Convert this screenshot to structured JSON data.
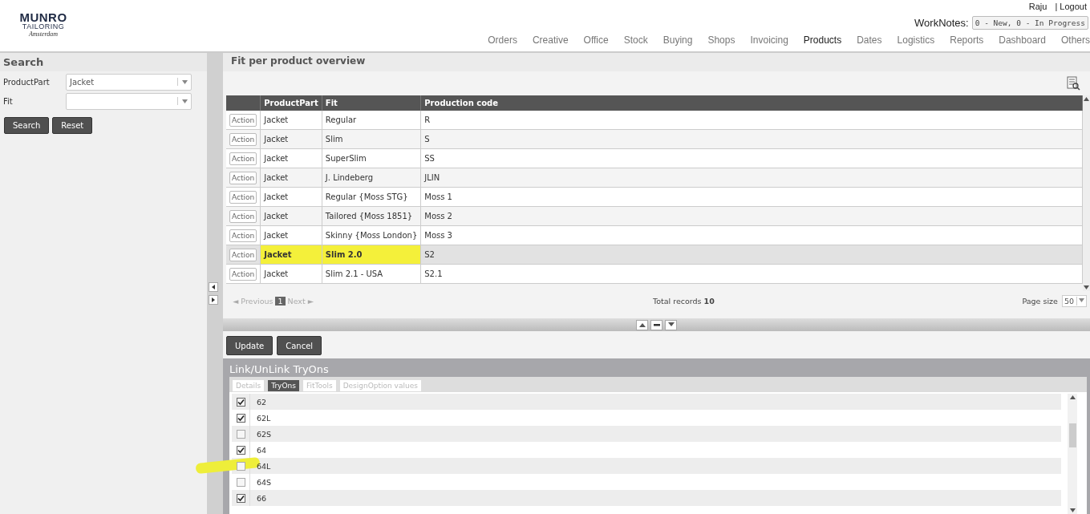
{
  "header": {
    "logo": {
      "name": "MUNRO",
      "sub": "TAILORING",
      "tagline": "Amsterdam"
    },
    "user": "Raju",
    "logout": "| Logout",
    "worknotes_label": "WorkNotes:",
    "worknotes_value": "0 - New, 0 - In Progress",
    "nav": [
      {
        "label": "Orders",
        "selected": false
      },
      {
        "label": "Creative",
        "selected": false
      },
      {
        "label": "Office",
        "selected": false
      },
      {
        "label": "Stock",
        "selected": false
      },
      {
        "label": "Buying",
        "selected": false
      },
      {
        "label": "Shops",
        "selected": false
      },
      {
        "label": "Invoicing",
        "selected": false
      },
      {
        "label": "Products",
        "selected": true
      },
      {
        "label": "Dates",
        "selected": false
      },
      {
        "label": "Logistics",
        "selected": false
      },
      {
        "label": "Reports",
        "selected": false
      },
      {
        "label": "Dashboard",
        "selected": false
      },
      {
        "label": "Others",
        "selected": false
      }
    ]
  },
  "search": {
    "title": "Search",
    "fields": [
      {
        "label": "ProductPart",
        "value": "Jacket"
      },
      {
        "label": "Fit"
      }
    ],
    "buttons": [
      "Search",
      "Reset"
    ]
  },
  "overview": {
    "title": "Fit per product overview",
    "columns": [
      "",
      "ProductPart",
      "Fit",
      "Production code"
    ],
    "rows": [
      {
        "action": "Action",
        "part": "Jacket",
        "fit": "Regular",
        "code": "R",
        "selected": false,
        "marked": false
      },
      {
        "action": "Action",
        "part": "Jacket",
        "fit": "Slim",
        "code": "S",
        "selected": false,
        "marked": false
      },
      {
        "action": "Action",
        "part": "Jacket",
        "fit": "SuperSlim",
        "code": "SS",
        "selected": false,
        "marked": false
      },
      {
        "action": "Action",
        "part": "Jacket",
        "fit": "J. Lindeberg",
        "code": "JLIN",
        "selected": false,
        "marked": false
      },
      {
        "action": "Action",
        "part": "Jacket",
        "fit": "Regular {Moss STG}",
        "code": "Moss 1",
        "selected": false,
        "marked": false
      },
      {
        "action": "Action",
        "part": "Jacket",
        "fit": "Tailored {Moss 1851}",
        "code": "Moss 2",
        "selected": false,
        "marked": false
      },
      {
        "action": "Action",
        "part": "Jacket",
        "fit": "Skinny {Moss London}",
        "code": "Moss 3",
        "selected": false,
        "marked": false
      },
      {
        "action": "Action",
        "part": "Jacket",
        "fit": "Slim 2.0",
        "code": "S2",
        "selected": true,
        "marked": true
      },
      {
        "action": "Action",
        "part": "Jacket",
        "fit": "Slim 2.1 - USA",
        "code": "S2.1",
        "selected": false,
        "marked": false
      }
    ],
    "pager": {
      "previous": "◄ Previous",
      "page": "1",
      "next": "Next ►"
    },
    "total_label": "Total records",
    "total": "10",
    "page_size_label": "Page size",
    "page_size": "50"
  },
  "actions": [
    "Update",
    "Cancel"
  ],
  "tryons": {
    "title": "Link/UnLink TryOns",
    "tabs": [
      {
        "label": "Details",
        "selected": false
      },
      {
        "label": "TryOns",
        "selected": true
      },
      {
        "label": "FitTools",
        "selected": false
      },
      {
        "label": "DesignOption values",
        "selected": false
      }
    ],
    "items": [
      {
        "label": "62",
        "checked": true,
        "marked": false
      },
      {
        "label": "62L",
        "checked": true,
        "marked": false
      },
      {
        "label": "62S",
        "checked": false,
        "marked": false
      },
      {
        "label": "64",
        "checked": true,
        "marked": false
      },
      {
        "label": "64L",
        "checked": false,
        "marked": true
      },
      {
        "label": "64S",
        "checked": false,
        "marked": false
      },
      {
        "label": "66",
        "checked": true,
        "marked": false
      }
    ]
  }
}
